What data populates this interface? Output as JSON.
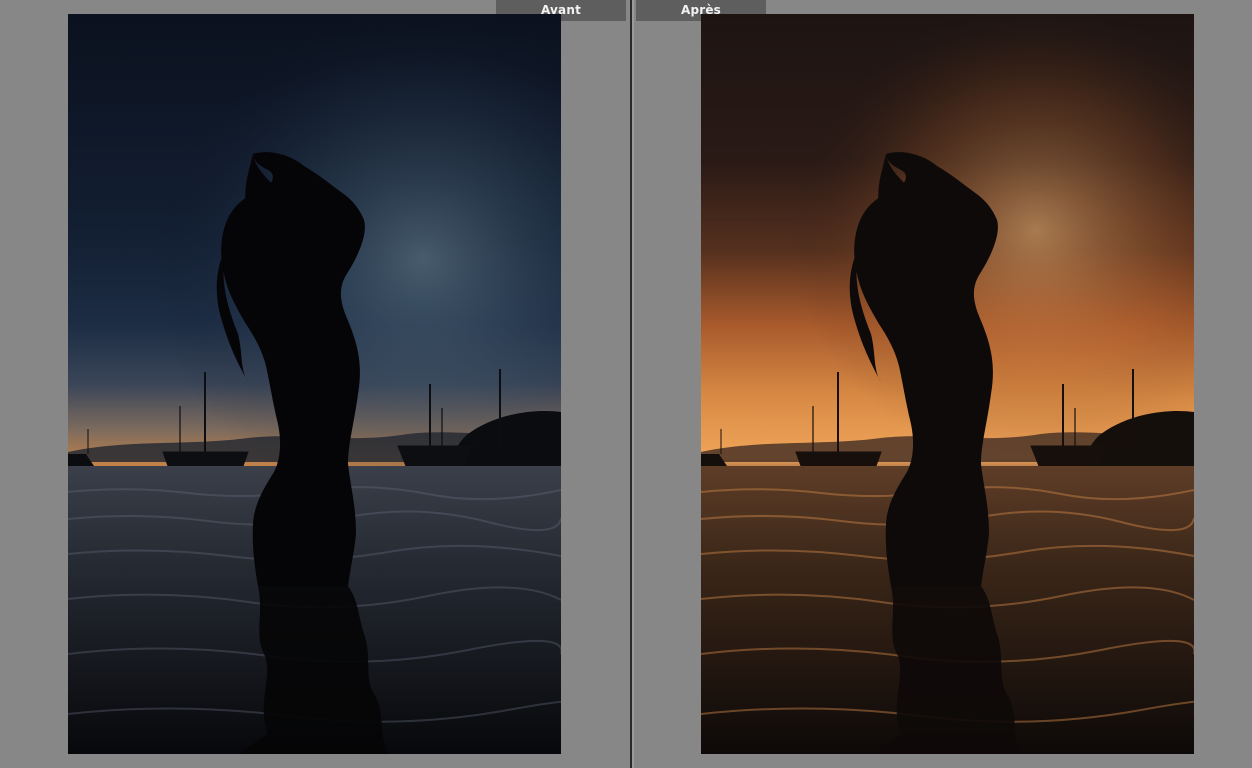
{
  "tabs": {
    "before_label": "Avant",
    "after_label": "Après"
  },
  "colors": {
    "workspace_bg": "#878787",
    "tab_bg": "#5e5e5e",
    "before_sky_top": "#0b111e",
    "before_sky_horizon": "#c3834a",
    "after_sky_top": "#1d1412",
    "after_sky_horizon": "#f0a55a"
  },
  "icons": {
    "before_image": "photo-silhouette-sunset-cool",
    "after_image": "photo-silhouette-sunset-warm"
  }
}
